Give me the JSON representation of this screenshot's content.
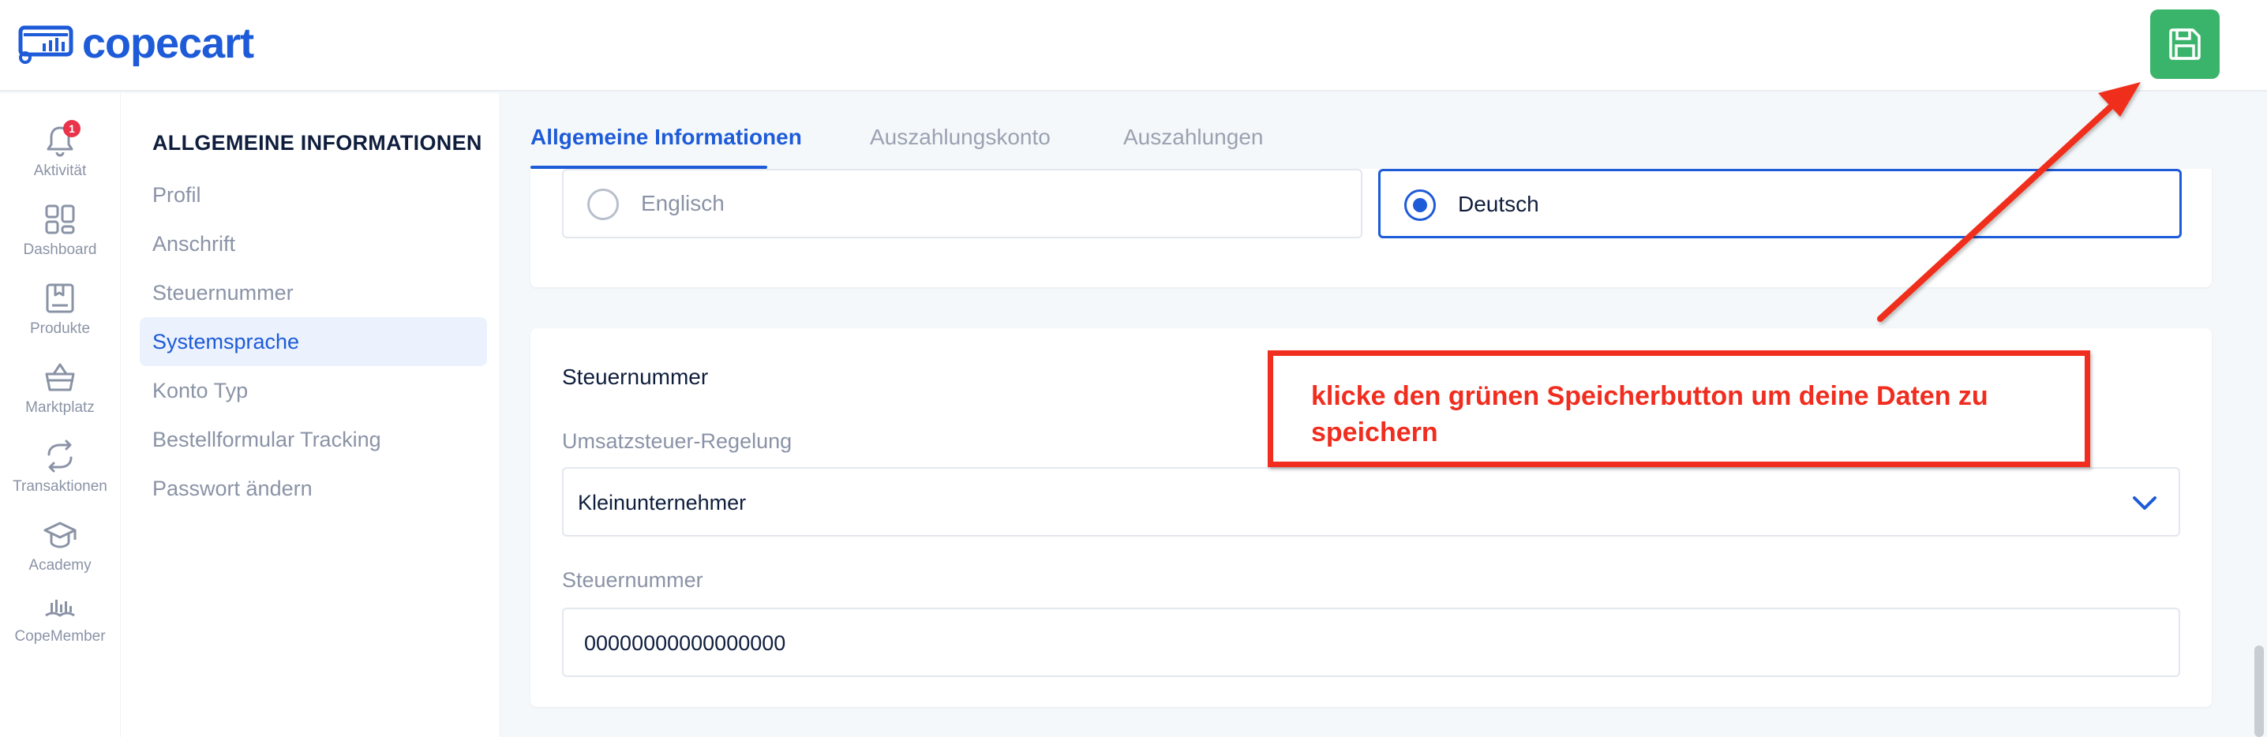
{
  "app": {
    "logo_text": "copecart",
    "save_icon": "floppy-disk-icon",
    "brand_color": "#1d5bd8",
    "save_color": "#3bb46b"
  },
  "rail": {
    "notification_count": "1",
    "items": [
      {
        "label": "Aktivität",
        "icon": "bell-icon"
      },
      {
        "label": "Dashboard",
        "icon": "dashboard-grid-icon"
      },
      {
        "label": "Produkte",
        "icon": "product-box-icon"
      },
      {
        "label": "Marktplatz",
        "icon": "basket-icon"
      },
      {
        "label": "Transaktionen",
        "icon": "transactions-icon"
      },
      {
        "label": "Academy",
        "icon": "graduation-cap-icon"
      },
      {
        "label": "CopeMember",
        "icon": "copemember-icon"
      }
    ]
  },
  "subnav": {
    "title": "ALLGEMEINE INFORMATIONEN",
    "items": [
      {
        "label": "Profil"
      },
      {
        "label": "Anschrift"
      },
      {
        "label": "Steuernummer"
      },
      {
        "label": "Systemsprache"
      },
      {
        "label": "Konto Typ"
      },
      {
        "label": "Bestellformular Tracking"
      },
      {
        "label": "Passwort ändern"
      }
    ],
    "active": "Systemsprache"
  },
  "tabs": [
    {
      "label": "Allgemeine Informationen"
    },
    {
      "label": "Auszahlungskonto"
    },
    {
      "label": "Auszahlungen"
    }
  ],
  "language": {
    "options": [
      {
        "label": "Englisch"
      },
      {
        "label": "Deutsch"
      }
    ],
    "selected": "Deutsch"
  },
  "tax": {
    "title": "Steuernummer",
    "regulation_label": "Umsatzsteuer-Regelung",
    "regulation_value": "Kleinunternehmer",
    "number_label": "Steuernummer",
    "number_value": "00000000000000000"
  },
  "callout": {
    "text": "klicke den grünen Speicherbutton um deine Daten zu speichern",
    "color": "#f02d1f"
  }
}
